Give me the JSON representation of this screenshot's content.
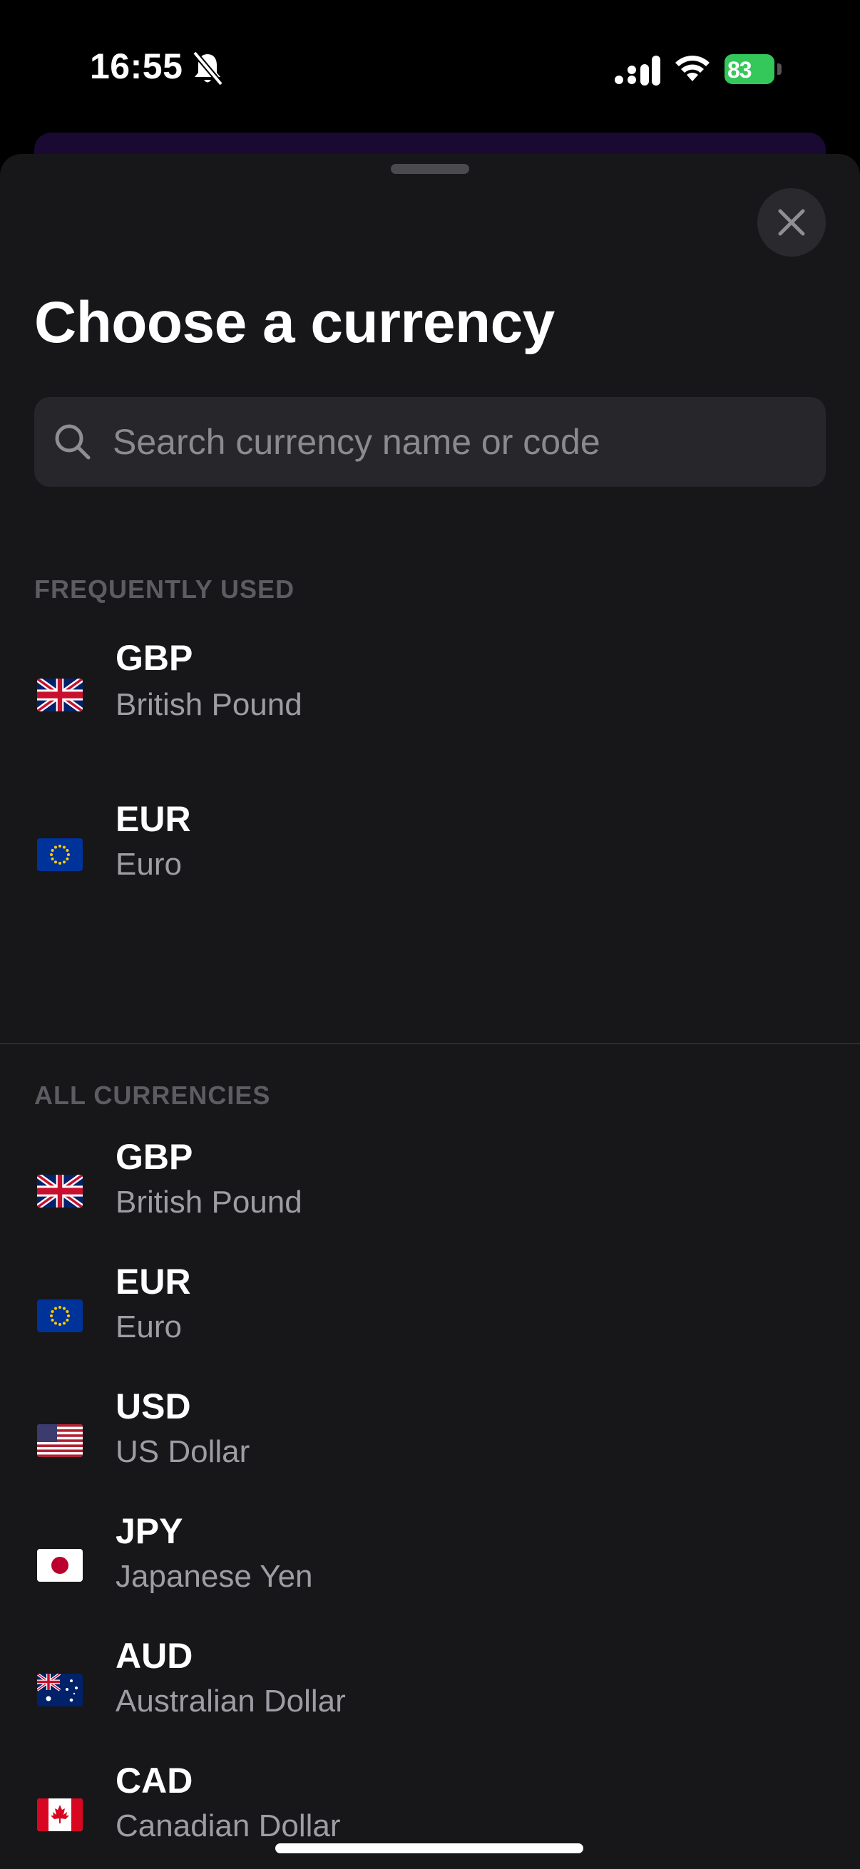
{
  "status_bar": {
    "time": "16:55",
    "battery": "83"
  },
  "sheet": {
    "title": "Choose a currency",
    "search_placeholder": "Search currency name or code",
    "frequently_used_label": "FREQUENTLY USED",
    "all_currencies_label": "ALL CURRENCIES"
  },
  "frequently_used": [
    {
      "code": "GBP",
      "name": "British Pound",
      "flag": "uk-flag-icon"
    },
    {
      "code": "EUR",
      "name": "Euro",
      "flag": "eu-flag-icon"
    }
  ],
  "all_currencies": [
    {
      "code": "GBP",
      "name": "British Pound",
      "flag": "uk-flag-icon"
    },
    {
      "code": "EUR",
      "name": "Euro",
      "flag": "eu-flag-icon"
    },
    {
      "code": "USD",
      "name": "US Dollar",
      "flag": "us-flag-icon"
    },
    {
      "code": "JPY",
      "name": "Japanese Yen",
      "flag": "japan-flag-icon"
    },
    {
      "code": "AUD",
      "name": "Australian Dollar",
      "flag": "australia-flag-icon"
    },
    {
      "code": "CAD",
      "name": "Canadian Dollar",
      "flag": "canada-flag-icon"
    }
  ],
  "colors": {
    "sheet_bg": "#17171a",
    "battery": "#34c759",
    "secondary_text": "#9d9da3"
  }
}
